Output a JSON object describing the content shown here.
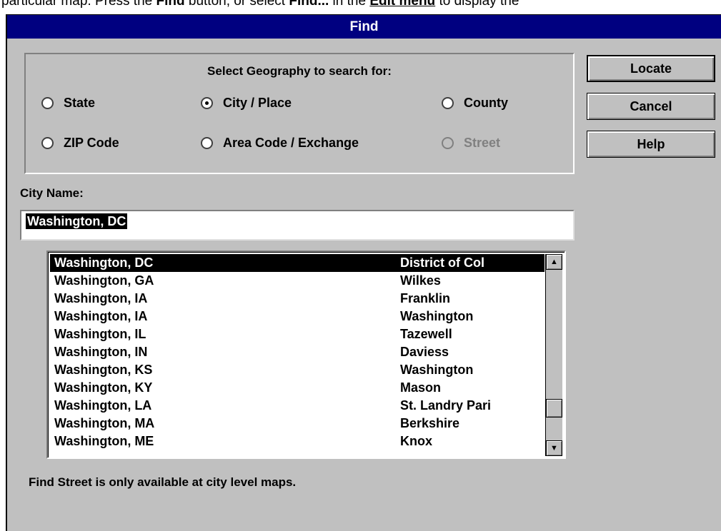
{
  "help_text": {
    "prefix": "particular map.  Press the ",
    "find_word": "Find",
    "middle": " button, or select ",
    "findit": "Find...",
    "in_the": " in the ",
    "menu_link": "Edit menu",
    "suffix": " to display the"
  },
  "dialog": {
    "title": "Find",
    "geography_group": {
      "title": "Select Geography to search for:",
      "options": [
        {
          "label": "State",
          "checked": false,
          "enabled": true
        },
        {
          "label": "City / Place",
          "checked": true,
          "enabled": true
        },
        {
          "label": "County",
          "checked": false,
          "enabled": true
        },
        {
          "label": "ZIP Code",
          "checked": false,
          "enabled": true
        },
        {
          "label": "Area Code / Exchange",
          "checked": false,
          "enabled": true
        },
        {
          "label": "Street",
          "checked": false,
          "enabled": false
        }
      ]
    },
    "buttons": {
      "locate": "Locate",
      "cancel": "Cancel",
      "help": "Help"
    },
    "city_field": {
      "label": "City Name:",
      "value": "Washington, DC"
    },
    "results": [
      {
        "city": "Washington, DC",
        "county": "District of Col",
        "selected": true
      },
      {
        "city": "Washington, GA",
        "county": "Wilkes"
      },
      {
        "city": "Washington, IA",
        "county": "Franklin"
      },
      {
        "city": "Washington, IA",
        "county": "Washington"
      },
      {
        "city": "Washington, IL",
        "county": "Tazewell"
      },
      {
        "city": "Washington, IN",
        "county": "Daviess"
      },
      {
        "city": "Washington, KS",
        "county": "Washington"
      },
      {
        "city": "Washington, KY",
        "county": "Mason"
      },
      {
        "city": "Washington, LA",
        "county": "St. Landry Pari"
      },
      {
        "city": "Washington, MA",
        "county": "Berkshire"
      },
      {
        "city": "Washington, ME",
        "county": "Knox"
      }
    ],
    "scrollbar": {
      "up": "up-arrow-icon",
      "down": "down-arrow-icon",
      "position": 0.85
    },
    "status": "Find Street is only available at city level maps."
  },
  "colors": {
    "title_bar": "#000080",
    "dialog_face": "#c0c0c0",
    "selection": "#000000"
  }
}
